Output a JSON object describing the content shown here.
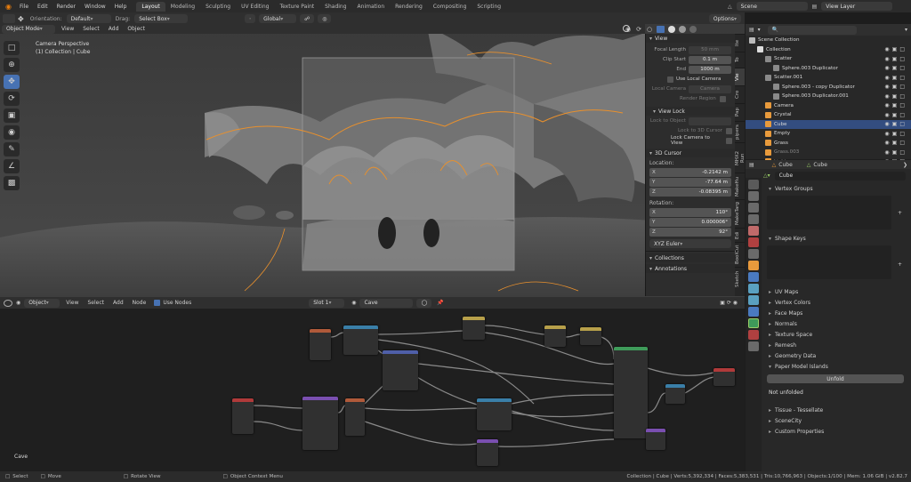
{
  "topbar": {
    "menus": [
      "File",
      "Edit",
      "Render",
      "Window",
      "Help"
    ],
    "workspaces": [
      "Layout",
      "Modeling",
      "Sculpting",
      "UV Editing",
      "Texture Paint",
      "Shading",
      "Animation",
      "Rendering",
      "Compositing",
      "Scripting"
    ],
    "active_workspace": "Layout",
    "scene": "Scene",
    "view_layer": "View Layer"
  },
  "viewport_header": {
    "orientation_label": "Orientation:",
    "orientation_value": "Default",
    "drag_label": "Drag:",
    "drag_value": "Select Box",
    "transform_orientation": "Global",
    "options": "Options",
    "mode": "Object Mode",
    "menus": [
      "View",
      "Select",
      "Add",
      "Object"
    ]
  },
  "viewport": {
    "camera_label": "Camera Perspective",
    "object_label": "(1) Collection | Cube"
  },
  "npanel": {
    "view_header": "View",
    "focal_length_label": "Focal Length",
    "focal_length": "50 mm",
    "clip_start_label": "Clip Start",
    "clip_start": "0.1 m",
    "clip_end_label": "End",
    "clip_end": "1000 m",
    "use_local_camera": "Use Local Camera",
    "local_camera_label": "Local Camera",
    "local_camera_value": "Camera",
    "render_region": "Render Region",
    "view_lock_header": "View Lock",
    "lock_to_object": "Lock to Object",
    "lock_3d_cursor": "Lock to 3D Cursor",
    "lock_camera_view": "Lock Camera to View",
    "cursor_header": "3D Cursor",
    "location_label": "Location:",
    "loc_x": "-0.2142 m",
    "loc_y": "-77.64 m",
    "loc_z": "-0.08395 m",
    "rotation_label": "Rotation:",
    "rot_x": "110°",
    "rot_y": "0.000006°",
    "rot_z": "92°",
    "rotation_mode": "XYZ Euler",
    "collections": "Collections",
    "annotations": "Annotations",
    "tabs": [
      "Ite",
      "To",
      "Vie",
      "Cro",
      "Pap",
      "pipers",
      "MHX2 Run",
      "MakeHu",
      "MakeTarg",
      "Edi",
      "BoolCut",
      "Sketch"
    ]
  },
  "node_header": {
    "object": "Object",
    "menus": [
      "View",
      "Select",
      "Add",
      "Node"
    ],
    "use_nodes": "Use Nodes",
    "slot": "Slot 1",
    "material": "Cave"
  },
  "node_editor": {
    "material_label": "Cave"
  },
  "outliner": {
    "rows": [
      {
        "label": "Scene Collection",
        "indent": 0
      },
      {
        "label": "Collection",
        "indent": 1
      },
      {
        "label": "Scatter",
        "indent": 2
      },
      {
        "label": "Sphere.003 Duplicator",
        "indent": 3
      },
      {
        "label": "Scatter.001",
        "indent": 2
      },
      {
        "label": "Sphere.003 - copy Duplicator",
        "indent": 3
      },
      {
        "label": "Sphere.003 Duplicator.001",
        "indent": 3
      },
      {
        "label": "Camera",
        "indent": 2
      },
      {
        "label": "Crystal",
        "indent": 2
      },
      {
        "label": "Cube",
        "indent": 2
      },
      {
        "label": "Empty",
        "indent": 2
      },
      {
        "label": "Grass",
        "indent": 2
      },
      {
        "label": "Grass.003",
        "indent": 2
      },
      {
        "label": "Light",
        "indent": 2
      }
    ],
    "selected": "Cube"
  },
  "properties": {
    "breadcrumb_object": "Cube",
    "breadcrumb_data": "Cube",
    "data_name": "Cube",
    "vertex_groups": "Vertex Groups",
    "shape_keys": "Shape Keys",
    "sections": [
      "UV Maps",
      "Vertex Colors",
      "Face Maps",
      "Normals",
      "Texture Space",
      "Remesh",
      "Geometry Data",
      "Paper Model Islands"
    ],
    "unfold": "Unfold",
    "not_unfolded": "Not unfolded",
    "sections2": [
      "Tissue - Tessellate",
      "SceneCity",
      "Custom Properties"
    ]
  },
  "statusbar": {
    "select": "Select",
    "move": "Move",
    "rotate": "Rotate View",
    "context_menu": "Object Context Menu",
    "stats": "Collection | Cube | Verts:5,392,334 | Faces:5,383,531 | Tris:10,766,963 | Objects:1/100 | Mem: 1.06 GiB | v2.82.7"
  },
  "colors": {
    "accent": "#4772b3",
    "selection": "#334d80",
    "outline": "#e8902d"
  }
}
